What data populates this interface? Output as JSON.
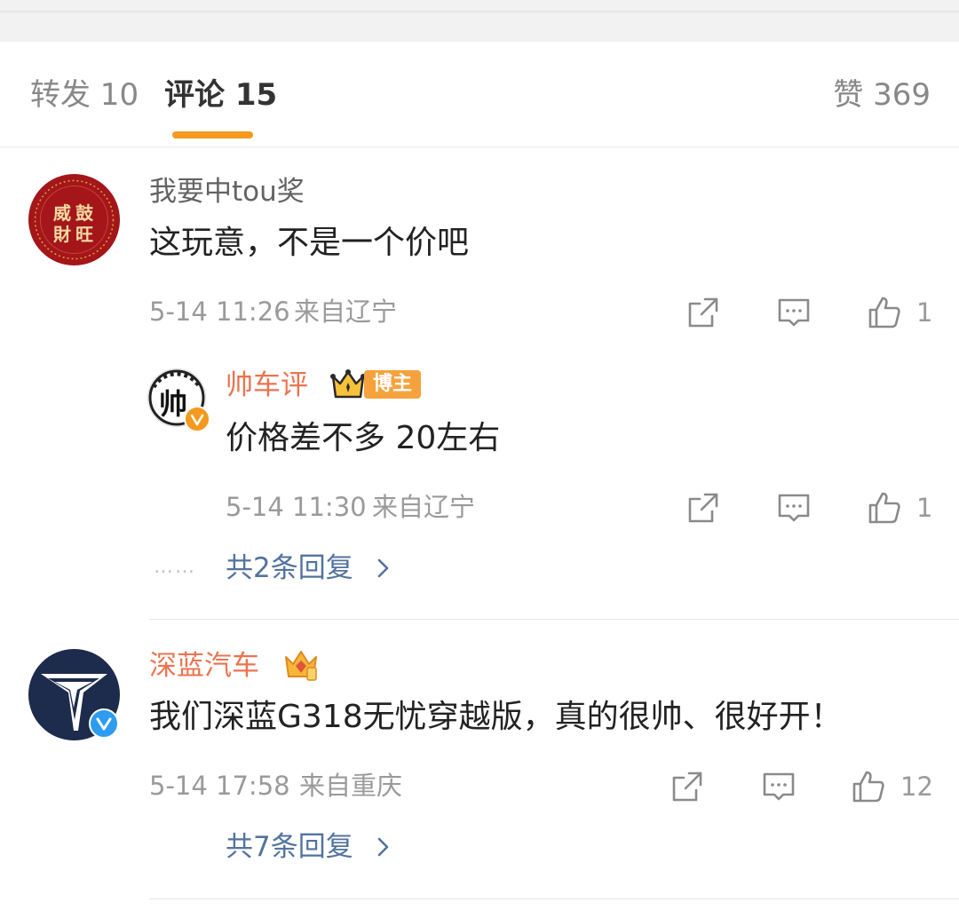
{
  "tabs": [
    {
      "label": "转发 10"
    },
    {
      "label": "评论 15"
    }
  ],
  "like_tab": {
    "label": "赞 369"
  },
  "comments": [
    {
      "username": "我要中tou奖",
      "text": "这玩意，不是一个价吧",
      "time": "5-14 11:26",
      "location": "来自辽宁",
      "likes": "1",
      "avatar_text": [
        "威",
        "鼓",
        "財",
        "旺"
      ],
      "reply": {
        "username": "帅车评",
        "badge": "博主",
        "text": "价格差不多 20左右",
        "time": "5-14 11:30",
        "location": "来自辽宁",
        "likes": "1",
        "avatar_text": "帅"
      },
      "more_replies": "共2条回复",
      "dots": "……"
    },
    {
      "username": "深蓝汽车",
      "text": "我们深蓝G318无忧穿越版，真的很帅、很好开！",
      "time": "5-14 17:58",
      "location": "来自重庆",
      "likes": "12",
      "more_replies": "共7条回复"
    }
  ],
  "icons": {
    "share": "share-icon",
    "comment": "comment-icon",
    "like": "thumbs-up-icon",
    "chevron": "chevron-right-icon",
    "verified": "verified-icon",
    "crown": "crown-icon"
  },
  "colors": {
    "accent": "#f39a1f",
    "name_orange": "#eb7350",
    "link_blue": "#52739e",
    "verified_blue": "#2d9cf0",
    "verified_orange": "#f39a1f"
  }
}
